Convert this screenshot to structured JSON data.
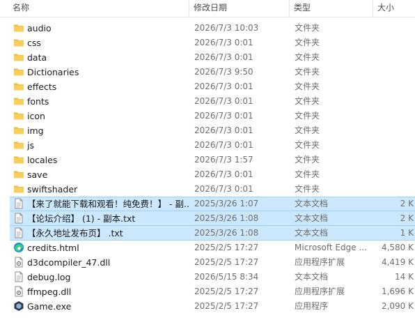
{
  "columns": {
    "name": "名称",
    "date": "修改日期",
    "type": "类型",
    "size": "大小"
  },
  "files": [
    {
      "name": "audio",
      "date": "2026/7/3 10:03",
      "type": "文件夹",
      "size": "",
      "icon": "folder-icon",
      "selected": false
    },
    {
      "name": "css",
      "date": "2026/7/3 0:01",
      "type": "文件夹",
      "size": "",
      "icon": "folder-icon",
      "selected": false
    },
    {
      "name": "data",
      "date": "2026/7/3 0:01",
      "type": "文件夹",
      "size": "",
      "icon": "folder-icon",
      "selected": false
    },
    {
      "name": "Dictionaries",
      "date": "2026/7/3 9:50",
      "type": "文件夹",
      "size": "",
      "icon": "folder-icon",
      "selected": false
    },
    {
      "name": "effects",
      "date": "2026/7/3 0:01",
      "type": "文件夹",
      "size": "",
      "icon": "folder-icon",
      "selected": false
    },
    {
      "name": "fonts",
      "date": "2026/7/3 0:01",
      "type": "文件夹",
      "size": "",
      "icon": "folder-icon",
      "selected": false
    },
    {
      "name": "icon",
      "date": "2026/7/3 0:01",
      "type": "文件夹",
      "size": "",
      "icon": "folder-icon",
      "selected": false
    },
    {
      "name": "img",
      "date": "2026/7/3 0:01",
      "type": "文件夹",
      "size": "",
      "icon": "folder-icon",
      "selected": false
    },
    {
      "name": "js",
      "date": "2026/7/3 0:01",
      "type": "文件夹",
      "size": "",
      "icon": "folder-icon",
      "selected": false
    },
    {
      "name": "locales",
      "date": "2026/7/3 1:57",
      "type": "文件夹",
      "size": "",
      "icon": "folder-icon",
      "selected": false
    },
    {
      "name": "save",
      "date": "2026/7/3 0:01",
      "type": "文件夹",
      "size": "",
      "icon": "folder-icon",
      "selected": false
    },
    {
      "name": "swiftshader",
      "date": "2026/7/3 0:01",
      "type": "文件夹",
      "size": "",
      "icon": "folder-icon",
      "selected": false
    },
    {
      "name": "【来了就能下载和观看！纯免费！】 - 副...",
      "date": "2025/3/26 1:07",
      "type": "文本文档",
      "size": "2 K",
      "icon": "text-document-icon",
      "selected": true
    },
    {
      "name": "【论坛介绍】 (1) - 副本.txt",
      "date": "2025/3/26 1:08",
      "type": "文本文档",
      "size": "2 K",
      "icon": "text-document-icon",
      "selected": true
    },
    {
      "name": "【永久地址发布页】 .txt",
      "date": "2025/3/26 1:08",
      "type": "文本文档",
      "size": "1 K",
      "icon": "text-document-icon",
      "selected": true
    },
    {
      "name": "credits.html",
      "date": "2025/2/5 17:27",
      "type": "Microsoft Edge ...",
      "size": "4,580 K",
      "icon": "edge-html-icon",
      "selected": false
    },
    {
      "name": "d3dcompiler_47.dll",
      "date": "2025/2/5 17:27",
      "type": "应用程序扩展",
      "size": "4,419 K",
      "icon": "dll-file-icon",
      "selected": false
    },
    {
      "name": "debug.log",
      "date": "2026/5/15 8:34",
      "type": "文本文档",
      "size": "14 K",
      "icon": "text-document-icon",
      "selected": false
    },
    {
      "name": "ffmpeg.dll",
      "date": "2025/2/5 17:27",
      "type": "应用程序扩展",
      "size": "1,696 K",
      "icon": "dll-file-icon",
      "selected": false
    },
    {
      "name": "Game.exe",
      "date": "2025/2/5 17:27",
      "type": "应用程序",
      "size": "2,090 K",
      "icon": "game-exe-icon",
      "selected": false
    }
  ]
}
